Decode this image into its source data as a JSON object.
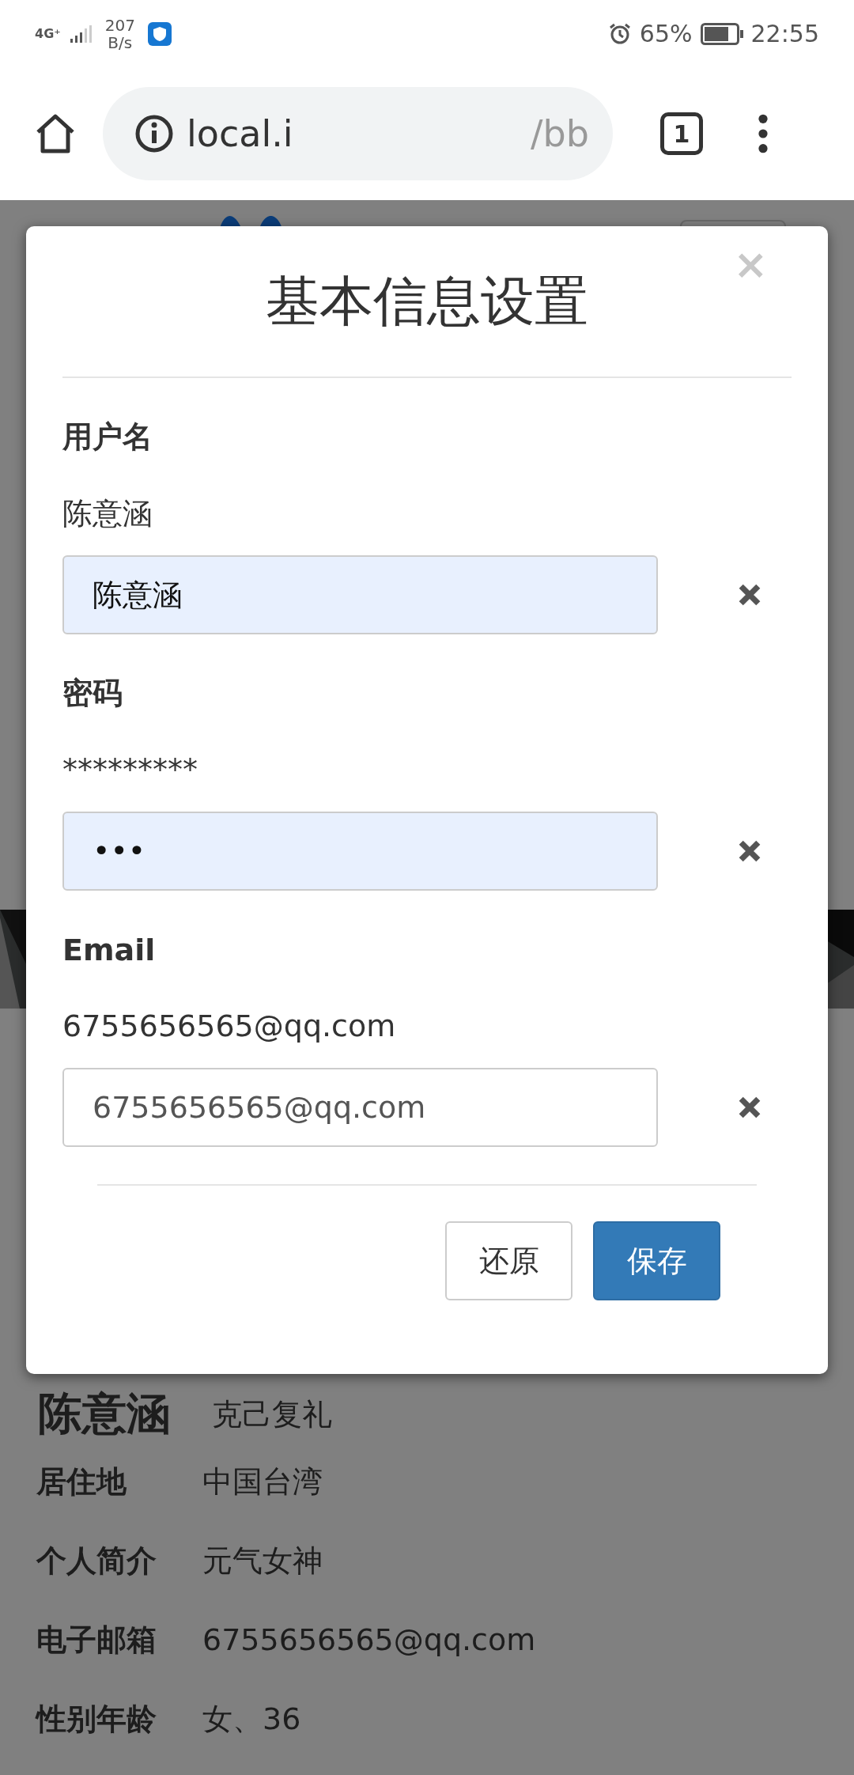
{
  "status_bar": {
    "network": "4G⁺",
    "speed_value": "207",
    "speed_unit": "B/s",
    "battery": "65%",
    "time": "22:55"
  },
  "browser": {
    "url_start": "local.i",
    "url_end": "/bb",
    "tab_count": "1"
  },
  "profile": {
    "name": "陈意涵",
    "motto": "克己复礼",
    "rows": [
      {
        "label": "居住地",
        "value": "中国台湾"
      },
      {
        "label": "个人简介",
        "value": "元气女神"
      },
      {
        "label": "电子邮箱",
        "value": "6755656565@qq.com"
      },
      {
        "label": "性别年龄",
        "value": "女、36"
      }
    ]
  },
  "dialog": {
    "title": "基本信息设置",
    "close": "×",
    "fields": [
      {
        "label": "用户名",
        "current": "陈意涵",
        "value": "陈意涵",
        "autofilled": true
      },
      {
        "label": "密码",
        "current": "*********",
        "value": "•••",
        "autofilled": true
      },
      {
        "label": "Email",
        "current": "6755656565@qq.com",
        "value": "6755656565@qq.com",
        "autofilled": false
      }
    ],
    "buttons": [
      {
        "label": "还原",
        "kind": "default"
      },
      {
        "label": "保存",
        "kind": "primary"
      }
    ]
  }
}
